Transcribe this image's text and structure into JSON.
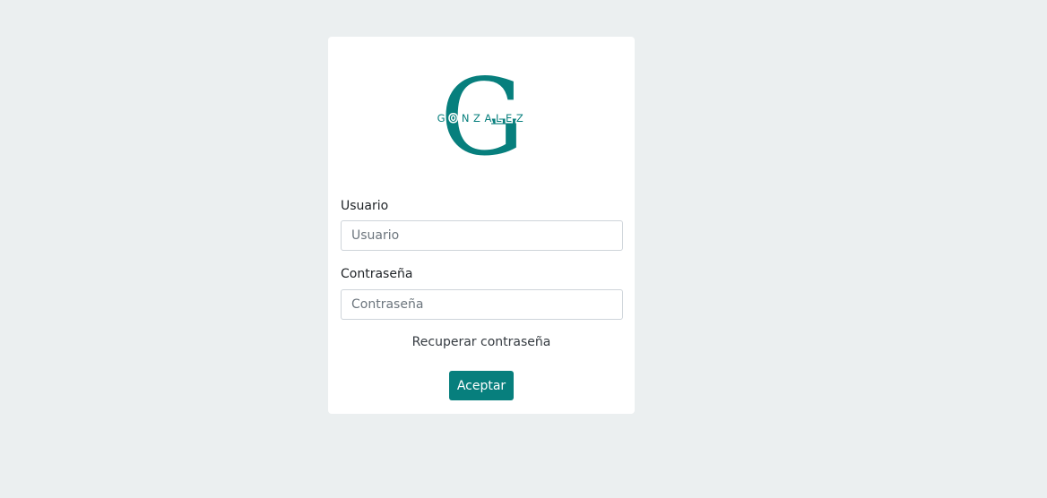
{
  "logo": {
    "letter": "G",
    "wordmark": "GONZALEZ",
    "color": "#077f7d"
  },
  "form": {
    "username_label": "Usuario",
    "username_placeholder": "Usuario",
    "username_value": "",
    "password_label": "Contraseña",
    "password_placeholder": "Contraseña",
    "password_value": "",
    "recover_link": "Recuperar contraseña",
    "submit_label": "Aceptar"
  },
  "colors": {
    "background": "#ebeff0",
    "card": "#ffffff",
    "accent": "#077f7d"
  }
}
